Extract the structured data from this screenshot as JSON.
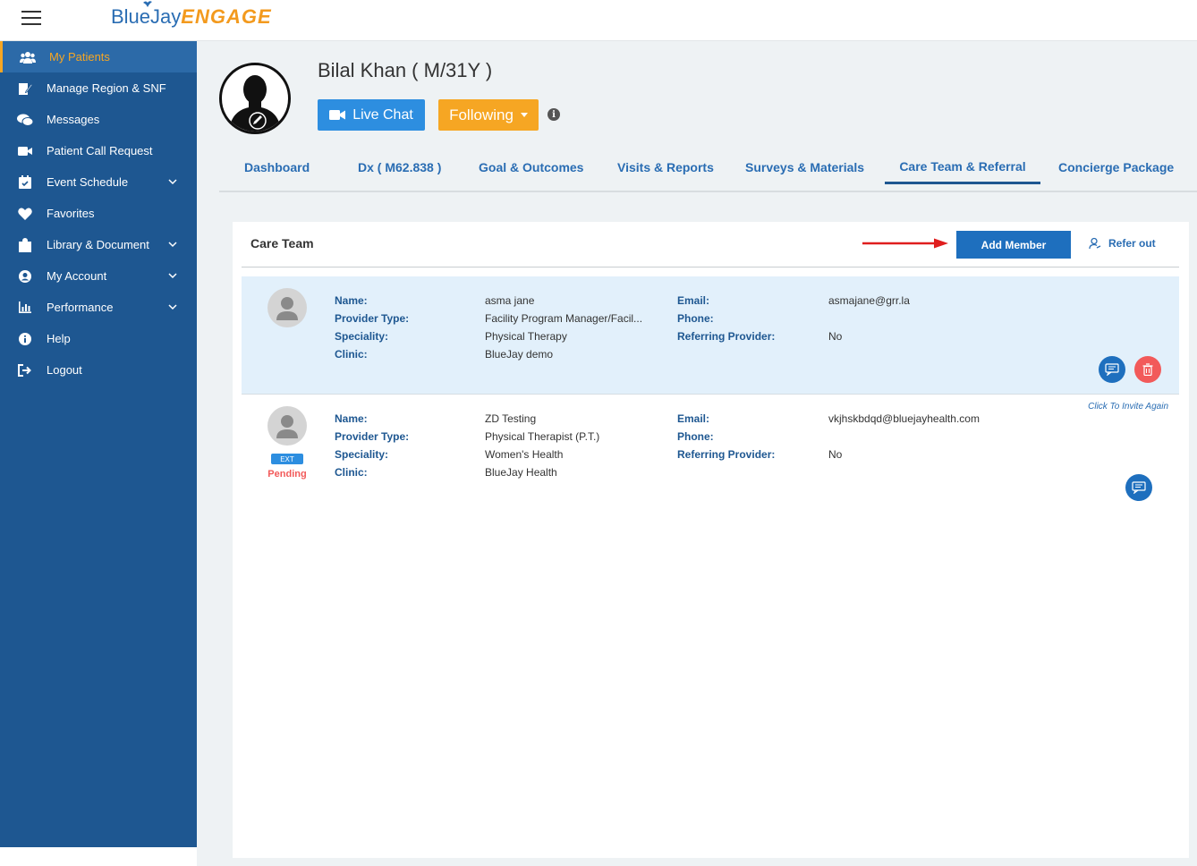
{
  "app": {
    "logo_part1": "BlueJay",
    "logo_part2": "ENGAGE"
  },
  "sidebar": {
    "items": [
      {
        "label": "My Patients",
        "icon": "users-icon",
        "active": true
      },
      {
        "label": "Manage Region & SNF",
        "icon": "edit-doc-icon"
      },
      {
        "label": "Messages",
        "icon": "chat-icon"
      },
      {
        "label": "Patient Call Request",
        "icon": "video-icon"
      },
      {
        "label": "Event Schedule",
        "icon": "calendar-icon",
        "expandable": true
      },
      {
        "label": "Favorites",
        "icon": "heart-icon"
      },
      {
        "label": "Library & Document",
        "icon": "library-icon",
        "expandable": true
      },
      {
        "label": "My Account",
        "icon": "user-circle-icon",
        "expandable": true
      },
      {
        "label": "Performance",
        "icon": "chart-icon",
        "expandable": true
      },
      {
        "label": "Help",
        "icon": "info-icon"
      },
      {
        "label": "Logout",
        "icon": "logout-icon"
      }
    ]
  },
  "patient": {
    "name": "Bilal Khan ( M/31Y )",
    "live_chat_label": "Live Chat",
    "following_label": "Following"
  },
  "tabs": [
    {
      "label": "Dashboard"
    },
    {
      "label": "Dx ( M62.838 )"
    },
    {
      "label": "Goal & Outcomes"
    },
    {
      "label": "Visits & Reports"
    },
    {
      "label": "Surveys & Materials"
    },
    {
      "label": "Care Team & Referral",
      "active": true
    },
    {
      "label": "Concierge Package"
    }
  ],
  "care_team": {
    "title": "Care Team",
    "add_member_label": "Add Member",
    "refer_out_label": "Refer out",
    "field_labels": {
      "name": "Name:",
      "provider_type": "Provider Type:",
      "speciality": "Speciality:",
      "clinic": "Clinic:",
      "email": "Email:",
      "phone": "Phone:",
      "referring_provider": "Referring Provider:"
    },
    "members": [
      {
        "name": "asma jane",
        "provider_type": "Facility Program Manager/Facil...",
        "speciality": "Physical Therapy",
        "clinic": "BlueJay demo",
        "email": "asmajane@grr.la",
        "phone": "",
        "referring_provider": "No"
      },
      {
        "name": "ZD Testing",
        "provider_type": "Physical Therapist (P.T.)",
        "speciality": "Women's Health",
        "clinic": "BlueJay Health",
        "email": "vkjhskbdqd@bluejayhealth.com",
        "phone": "",
        "referring_provider": "No",
        "badge": "EXT",
        "status": "Pending",
        "invite_again": "Click To Invite Again"
      }
    ]
  },
  "colors": {
    "sidebar_bg": "#1e5791",
    "accent_orange": "#f6a623",
    "primary_blue": "#1e6fbe",
    "danger_red": "#f25a5a"
  }
}
